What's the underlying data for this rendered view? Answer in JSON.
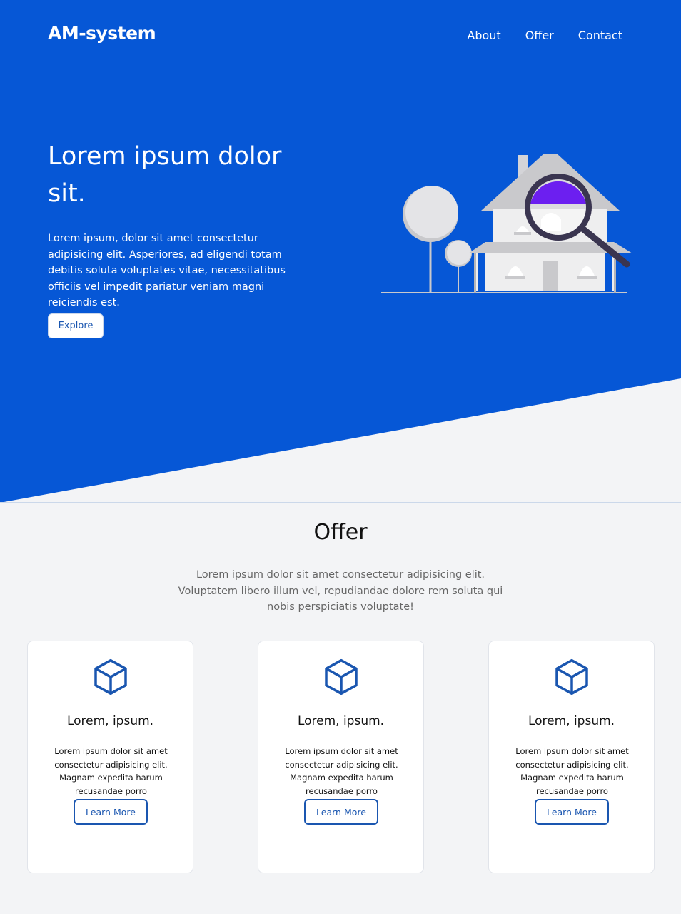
{
  "header": {
    "logo": "AM-system",
    "nav": [
      "About",
      "Offer",
      "Contact"
    ]
  },
  "hero": {
    "title": "Lorem ipsum dolor sit.",
    "text": "Lorem ipsum, dolor sit amet consectetur adipisicing elit. Asperiores, ad eligendi totam debitis soluta voluptates vitae, necessitatibus officiis vel impedit pariatur veniam magni reiciendis est.",
    "button": "Explore",
    "illustration": "house-search-illustration"
  },
  "offer": {
    "title": "Offer",
    "subtitle": "Lorem ipsum dolor sit amet consectetur adipisicing elit. Voluptatem libero illum vel, repudiandae dolore rem soluta qui nobis perspiciatis voluptate!",
    "cards": [
      {
        "icon": "box-icon",
        "title": "Lorem, ipsum.",
        "text": "Lorem ipsum dolor sit amet consectetur adipisicing elit. Magnam expedita harum recusandae porro",
        "button": "Learn More"
      },
      {
        "icon": "box-icon",
        "title": "Lorem, ipsum.",
        "text": "Lorem ipsum dolor sit amet consectetur adipisicing elit. Magnam expedita harum recusandae porro",
        "button": "Learn More"
      },
      {
        "icon": "box-icon",
        "title": "Lorem, ipsum.",
        "text": "Lorem ipsum dolor sit amet consectetur adipisicing elit. Magnam expedita harum recusandae porro",
        "button": "Learn More"
      }
    ]
  },
  "colors": {
    "primary": "#0657d6",
    "accent": "#1a56b0",
    "background": "#f3f4f6",
    "lens": "#6c1ff0"
  }
}
